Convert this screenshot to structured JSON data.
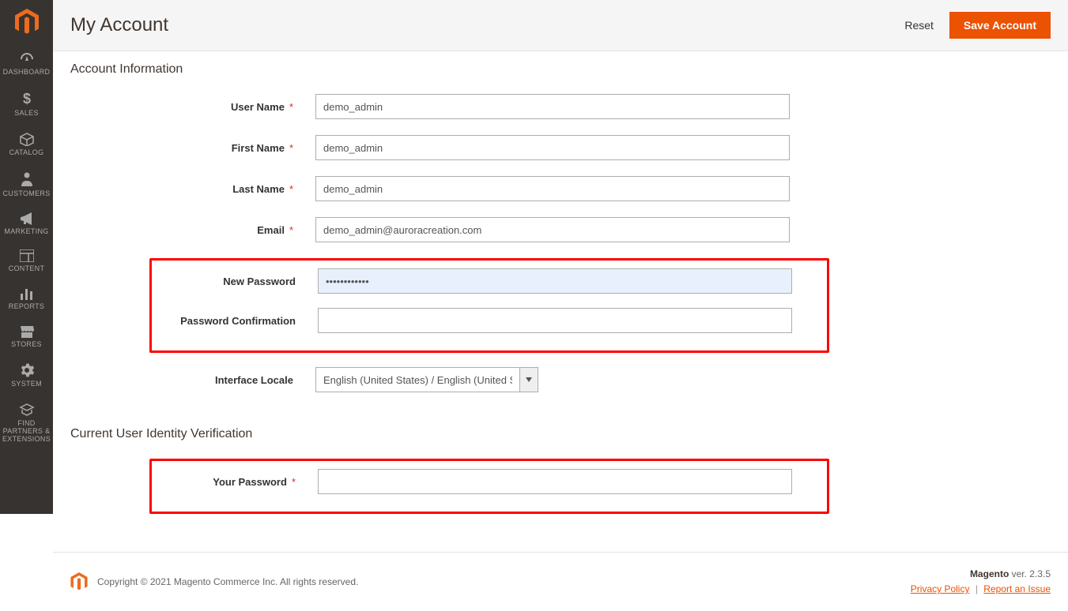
{
  "sidebar": {
    "items": [
      {
        "label": "DASHBOARD"
      },
      {
        "label": "SALES"
      },
      {
        "label": "CATALOG"
      },
      {
        "label": "CUSTOMERS"
      },
      {
        "label": "MARKETING"
      },
      {
        "label": "CONTENT"
      },
      {
        "label": "REPORTS"
      },
      {
        "label": "STORES"
      },
      {
        "label": "SYSTEM"
      },
      {
        "label": "FIND PARTNERS & EXTENSIONS"
      }
    ]
  },
  "header": {
    "title": "My Account",
    "reset_label": "Reset",
    "save_label": "Save Account"
  },
  "account_section": {
    "title": "Account Information",
    "labels": {
      "username": "User Name",
      "firstname": "First Name",
      "lastname": "Last Name",
      "email": "Email",
      "new_password": "New Password",
      "password_confirmation": "Password Confirmation",
      "interface_locale": "Interface Locale"
    },
    "values": {
      "username": "demo_admin",
      "firstname": "demo_admin",
      "lastname": "demo_admin",
      "email": "demo_admin@auroracreation.com",
      "new_password": "••••••••••••",
      "password_confirmation": "",
      "interface_locale": "English (United States) / English (United States)"
    }
  },
  "verification_section": {
    "title": "Current User Identity Verification",
    "labels": {
      "your_password": "Your Password"
    },
    "values": {
      "your_password": ""
    }
  },
  "footer": {
    "copyright": "Copyright © 2021 Magento Commerce Inc. All rights reserved.",
    "brand": "Magento",
    "version_prefix": " ver. ",
    "version": "2.3.5",
    "privacy": "Privacy Policy",
    "report": "Report an Issue"
  }
}
